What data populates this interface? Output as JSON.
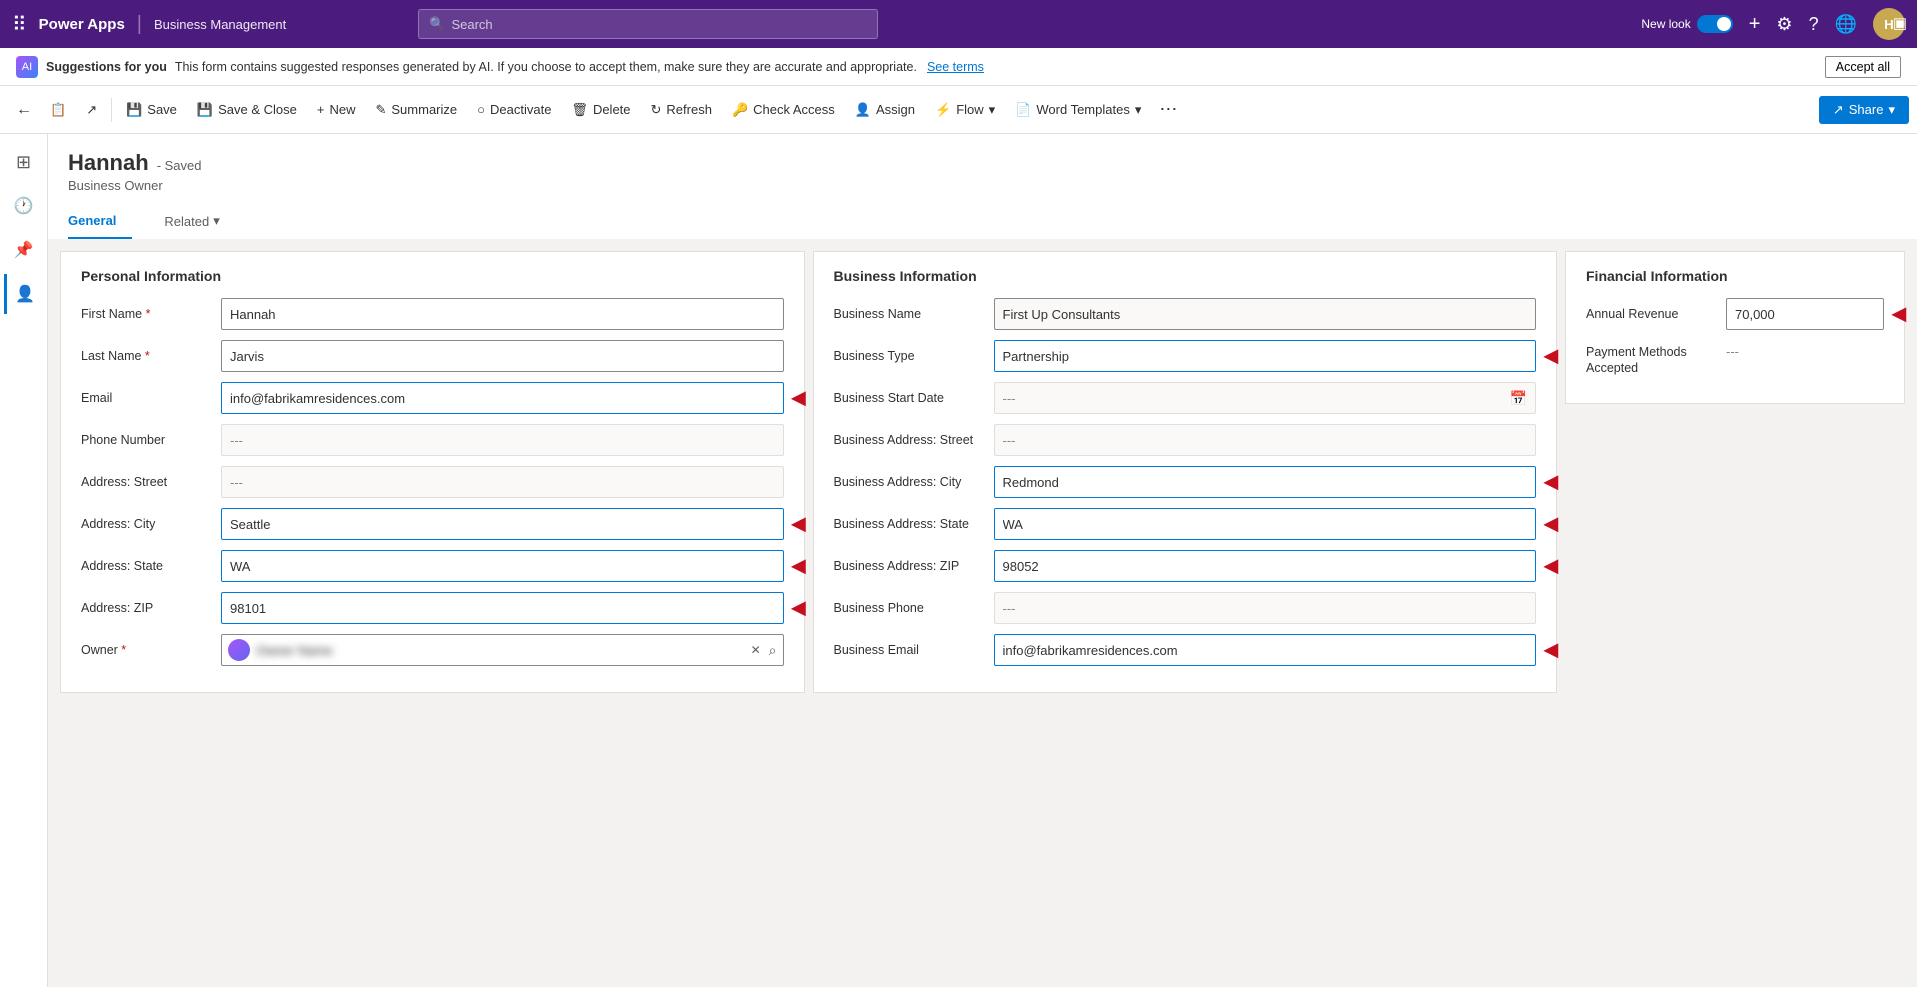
{
  "topnav": {
    "app_name": "Power Apps",
    "separator": "|",
    "module_name": "Business Management",
    "search_placeholder": "Search",
    "new_look_label": "New look",
    "plus_label": "+",
    "accept_all_label": "Accept all"
  },
  "suggestion_bar": {
    "label": "Suggestions for you",
    "text": "This form contains suggested responses generated by AI. If you choose to accept them, make sure they are accurate and appropriate.",
    "see_terms": "See terms"
  },
  "command_bar": {
    "back": "←",
    "save": "Save",
    "save_close": "Save & Close",
    "new": "New",
    "summarize": "Summarize",
    "deactivate": "Deactivate",
    "delete": "Delete",
    "refresh": "Refresh",
    "check_access": "Check Access",
    "assign": "Assign",
    "flow": "Flow",
    "word_templates": "Word Templates",
    "share": "Share",
    "more": "⋯"
  },
  "record": {
    "name": "Hannah",
    "saved_label": "- Saved",
    "subtitle": "Business Owner"
  },
  "tabs": {
    "general": "General",
    "related": "Related"
  },
  "personal_section": {
    "title": "Personal Information",
    "fields": [
      {
        "label": "First Name",
        "required": true,
        "value": "Hannah",
        "type": "input",
        "highlighted": false
      },
      {
        "label": "Last Name",
        "required": true,
        "value": "Jarvis",
        "type": "input",
        "highlighted": false
      },
      {
        "label": "Email",
        "required": false,
        "value": "info@fabrikamresidences.com",
        "type": "input",
        "highlighted": true,
        "arrow": true
      },
      {
        "label": "Phone Number",
        "required": false,
        "value": "---",
        "type": "dash"
      },
      {
        "label": "Address: Street",
        "required": false,
        "value": "---",
        "type": "dash"
      },
      {
        "label": "Address: City",
        "required": false,
        "value": "Seattle",
        "type": "input",
        "highlighted": true,
        "arrow": true
      },
      {
        "label": "Address: State",
        "required": false,
        "value": "WA",
        "type": "input",
        "highlighted": true,
        "arrow": true
      },
      {
        "label": "Address: ZIP",
        "required": false,
        "value": "98101",
        "type": "input",
        "highlighted": true,
        "arrow": true
      },
      {
        "label": "Owner",
        "required": true,
        "value": "owner_blurred",
        "type": "owner"
      }
    ]
  },
  "business_section": {
    "title": "Business Information",
    "fields": [
      {
        "label": "Business Name",
        "required": false,
        "value": "First Up Consultants",
        "type": "input-readonly"
      },
      {
        "label": "Business Type",
        "required": false,
        "value": "Partnership",
        "type": "input",
        "highlighted": true,
        "arrow": true
      },
      {
        "label": "Business Start Date",
        "required": false,
        "value": "---",
        "type": "date"
      },
      {
        "label": "Business Address: Street",
        "required": false,
        "value": "---",
        "type": "dash"
      },
      {
        "label": "Business Address: City",
        "required": false,
        "value": "Redmond",
        "type": "input",
        "highlighted": true,
        "arrow": true
      },
      {
        "label": "Business Address: State",
        "required": false,
        "value": "WA",
        "type": "input",
        "highlighted": true,
        "arrow": true
      },
      {
        "label": "Business Address: ZIP",
        "required": false,
        "value": "98052",
        "type": "input",
        "highlighted": true,
        "arrow": true
      },
      {
        "label": "Business Phone",
        "required": false,
        "value": "---",
        "type": "dash"
      },
      {
        "label": "Business Email",
        "required": false,
        "value": "info@fabrikamresidences.com",
        "type": "input",
        "highlighted": true,
        "arrow": true
      }
    ]
  },
  "financial_section": {
    "title": "Financial Information",
    "fields": [
      {
        "label": "Annual Revenue",
        "required": false,
        "value": "70,000",
        "type": "input",
        "highlighted": false,
        "arrow": true
      },
      {
        "label": "Payment Methods Accepted",
        "required": false,
        "value": "---",
        "type": "dash"
      }
    ]
  },
  "sidebar": {
    "icons": [
      {
        "name": "home-icon",
        "symbol": "⊞",
        "active": false
      },
      {
        "name": "recent-icon",
        "symbol": "🕐",
        "active": false
      },
      {
        "name": "pinned-icon",
        "symbol": "📌",
        "active": false
      },
      {
        "name": "contact-icon",
        "symbol": "👤",
        "active": true
      }
    ]
  }
}
